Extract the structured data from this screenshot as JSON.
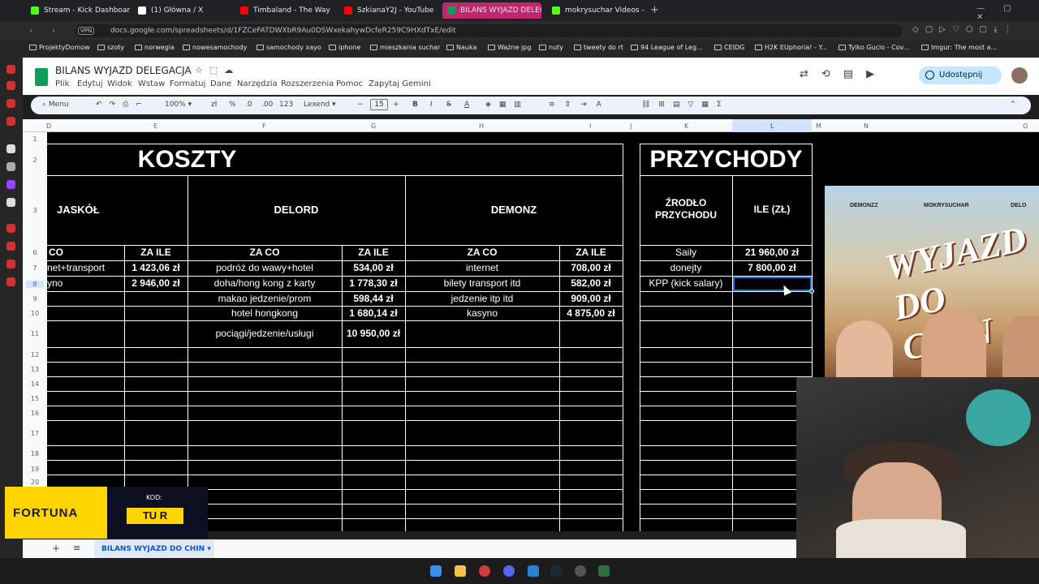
{
  "browser": {
    "tabs": [
      {
        "label": "Stream - Kick Dashboard",
        "color": "#53fc18"
      },
      {
        "label": "(1) Główna / X",
        "color": "#ffffff"
      },
      {
        "label": "Timbaland - The Way I Are",
        "color": "#ff0000"
      },
      {
        "label": "SzkianaY2J - YouTube",
        "color": "#ff0000"
      },
      {
        "label": "BILANS WYJAZD DELEGA",
        "color": "#0f9d58"
      },
      {
        "label": "mokrysuchar Videos - Wa",
        "color": "#53fc18"
      }
    ],
    "url": "docs.google.com/spreadsheets/d/1FZCeFATDWXbR9Au0DSWxekahywDcfeR259C9HXdTxE/edit",
    "vpn_label": "VPN",
    "bookmarks": [
      "ProjektyDomow",
      "szoty",
      "norwegia",
      "nowesamochody",
      "samochody xayo",
      "iphone",
      "mieszkania suchar",
      "Nauka",
      "Ważne jpg",
      "nuty",
      "tweety do rt",
      "94 League of Leg...",
      "CEIDG",
      "H2K EUphoria! - Y...",
      "Tylko Gucio - Cov...",
      "Imgur: The most a..."
    ]
  },
  "sheets": {
    "title": "BILANS WYJAZD DELEGACJA",
    "menu": [
      "Plik",
      "Edytuj",
      "Widok",
      "Wstaw",
      "Formatuj",
      "Dane",
      "Narzędzia",
      "Rozszerzenia",
      "Pomoc",
      "Zapytaj Gemini"
    ],
    "share_label": "Udostępnij",
    "toolbar": {
      "search": "Menu",
      "zoom": "100%",
      "currency": "zł",
      "percent": "%",
      "dec_minus": ".0",
      "dec_plus": ".00",
      "num_format": "123",
      "font": "Lexend",
      "font_size": "15",
      "bold": "B",
      "italic": "I",
      "text_color": "A"
    },
    "columns": [
      "D",
      "E",
      "F",
      "G",
      "H",
      "I",
      "J",
      "K",
      "L",
      "M",
      "N",
      "O"
    ],
    "rows": [
      "1",
      "2",
      "3",
      "6",
      "7",
      "8",
      "9",
      "10",
      "11",
      "12",
      "13",
      "14",
      "15",
      "16",
      "17",
      "18",
      "19",
      "20"
    ],
    "sheet_tab": "BILANS WYJAZD DO CHIN"
  },
  "table": {
    "koszty_title": "KOSZTY",
    "przychody_title": "PRZYCHODY",
    "people": [
      "JASKÓŁ",
      "DELORD",
      "DEMONZ"
    ],
    "src_header": "ŹRODŁO PRZYCHODU",
    "amount_header": "ILE (ZŁ)",
    "za_co": "ZA CO",
    "za_co_cut": "CO",
    "za_ile": "ZA ILE",
    "jaskol": [
      [
        "net+transport",
        "1 423,06 zł"
      ],
      [
        "yno",
        "2 946,00 zł"
      ]
    ],
    "delord": [
      [
        "podróż do wawy+hotel",
        "534,00 zł"
      ],
      [
        "doha/hong kong z karty",
        "1 778,30 zł"
      ],
      [
        "makao jedzenie/prom",
        "598,44 zł"
      ],
      [
        "hotel hongkong",
        "1 680,14 zł"
      ],
      [
        "pociągi/jedzenie/usługi",
        "10 950,00 zł"
      ]
    ],
    "demonz": [
      [
        "internet",
        "708,00 zł"
      ],
      [
        "bilety transport itd",
        "582,00 zł"
      ],
      [
        "jedzenie itp itd",
        "909,00 zł"
      ],
      [
        "kasyno",
        "4 875,00 zł"
      ]
    ],
    "income": [
      [
        "Saily",
        "21 960,00 zł"
      ],
      [
        "donejty",
        "7 800,00 zł"
      ],
      [
        "KPP (kick salary)",
        ""
      ]
    ]
  },
  "overlay": {
    "poster_names": [
      "DEMONZZ",
      "MOKRYSUCHAR",
      "DELO"
    ],
    "poster_title": "WYJAZD DO CHIN",
    "sponsor": "FORTUNA",
    "kod_label": "KOD:",
    "kod_value": "TU R"
  }
}
